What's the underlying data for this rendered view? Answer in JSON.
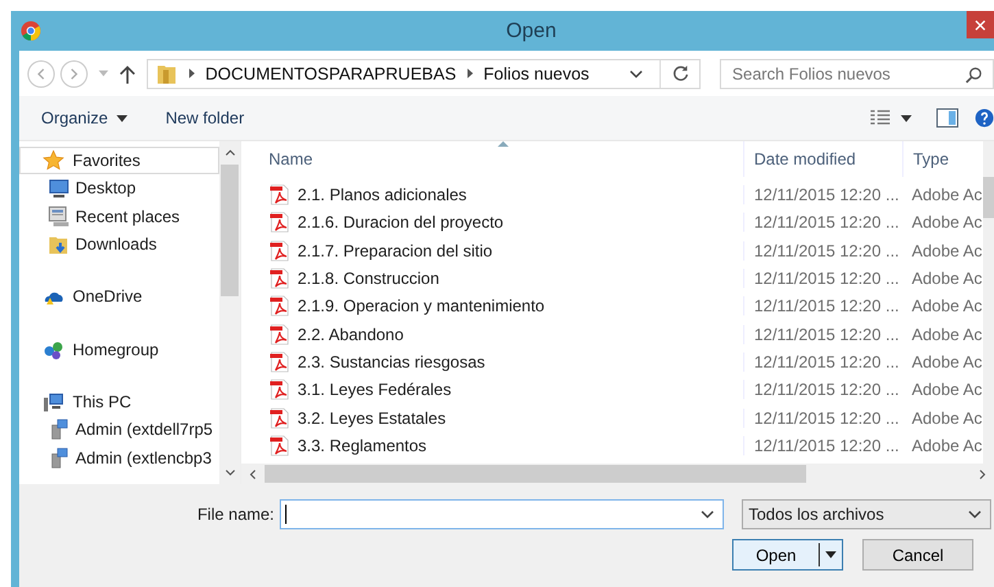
{
  "window": {
    "title": "Open"
  },
  "address": {
    "path": [
      "DOCUMENTOSPARAPRUEBAS",
      "Folios nuevos"
    ],
    "search_placeholder": "Search Folios nuevos"
  },
  "toolbar": {
    "organize": "Organize",
    "new_folder": "New folder"
  },
  "sidebar": {
    "items": [
      {
        "label": "Favorites",
        "kind": "star",
        "selected": true,
        "children": [
          {
            "label": "Desktop",
            "kind": "desktop",
            "selected": false
          },
          {
            "label": "Recent places",
            "kind": "recent",
            "selected": false
          },
          {
            "label": "Downloads",
            "kind": "downloads",
            "selected": false
          }
        ]
      },
      {
        "label": "OneDrive",
        "kind": "cloud",
        "selected": false
      },
      {
        "label": "Homegroup",
        "kind": "homegroup",
        "selected": false
      },
      {
        "label": "This PC",
        "kind": "pc",
        "selected": false,
        "children": [
          {
            "label": "Admin (extdell7rp5",
            "kind": "netdrive",
            "selected": false
          },
          {
            "label": "Admin (extlencbp3",
            "kind": "netdrive",
            "selected": false
          }
        ]
      }
    ]
  },
  "table": {
    "columns": [
      "Name",
      "Date modified",
      "Type"
    ],
    "rows": [
      {
        "name": "2.1. Planos adicionales",
        "date": "12/11/2015 12:20 ...",
        "type": "Adobe Ac"
      },
      {
        "name": "2.1.6. Duracion del proyecto",
        "date": "12/11/2015 12:20 ...",
        "type": "Adobe Ac"
      },
      {
        "name": "2.1.7. Preparacion del sitio",
        "date": "12/11/2015 12:20 ...",
        "type": "Adobe Ac"
      },
      {
        "name": "2.1.8. Construccion",
        "date": "12/11/2015 12:20 ...",
        "type": "Adobe Ac"
      },
      {
        "name": "2.1.9. Operacion y mantenimiento",
        "date": "12/11/2015 12:20 ...",
        "type": "Adobe Ac"
      },
      {
        "name": "2.2. Abandono",
        "date": "12/11/2015 12:20 ...",
        "type": "Adobe Ac"
      },
      {
        "name": "2.3. Sustancias riesgosas",
        "date": "12/11/2015 12:20 ...",
        "type": "Adobe Ac"
      },
      {
        "name": "3.1. Leyes Fedérales",
        "date": "12/11/2015 12:20 ...",
        "type": "Adobe Ac"
      },
      {
        "name": "3.2. Leyes Estatales",
        "date": "12/11/2015 12:20 ...",
        "type": "Adobe Ac"
      },
      {
        "name": "3.3. Reglamentos",
        "date": "12/11/2015 12:20 ...",
        "type": "Adobe Ac"
      }
    ]
  },
  "footer": {
    "file_name_label": "File name:",
    "filter": "Todos los archivos",
    "buttons": [
      "Open",
      "Cancel"
    ]
  }
}
